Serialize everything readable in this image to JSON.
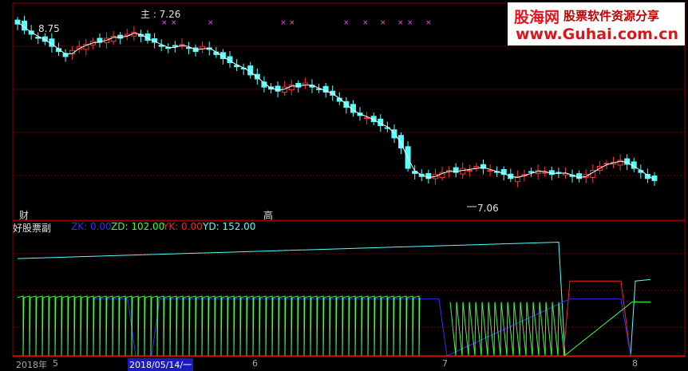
{
  "main_panel": {
    "label": "主 : 7.26",
    "high_label": "8.75",
    "low_label": "7.06",
    "bottom_tag_left": "财",
    "bottom_tag_mid": "高"
  },
  "indicator_panel": {
    "name": "好股票副",
    "zk": "ZK: 0.00",
    "zd": "ZD: 102.00",
    "yk": "YK: 0.00",
    "yd": "YD: 152.00"
  },
  "xaxis": {
    "labels": [
      "2018年",
      "5",
      "2018/05/14/一",
      "6",
      "7",
      "8"
    ]
  },
  "watermark": {
    "brand": "股海网",
    "slogan": "股票软件资源分享",
    "url": "www.Guhai.com.cn"
  },
  "colors": {
    "up": "#ff3333",
    "down": "#54ffff",
    "ma": "#ffffff",
    "zk": "#3030ff",
    "zd": "#38ff38",
    "yk": "#ff2020",
    "yd": "#54ffff",
    "grid": "#900000"
  },
  "chart_data": [
    {
      "type": "candlestick",
      "title": "",
      "annotations": [
        "8.75",
        "7.06"
      ],
      "ylim": [
        6.9,
        8.8
      ],
      "closes": [
        8.72,
        8.66,
        8.62,
        8.58,
        8.55,
        8.5,
        8.45,
        8.4,
        8.46,
        8.5,
        8.52,
        8.55,
        8.54,
        8.58,
        8.6,
        8.58,
        8.62,
        8.64,
        8.6,
        8.56,
        8.54,
        8.5,
        8.48,
        8.5,
        8.52,
        8.48,
        8.45,
        8.5,
        8.47,
        8.42,
        8.38,
        8.34,
        8.3,
        8.28,
        8.22,
        8.18,
        8.1,
        8.08,
        8.06,
        8.1,
        8.12,
        8.1,
        8.14,
        8.1,
        8.08,
        8.05,
        8.02,
        7.96,
        7.9,
        7.85,
        7.82,
        7.8,
        7.76,
        7.72,
        7.7,
        7.6,
        7.5,
        7.3,
        7.25,
        7.22,
        7.2,
        7.24,
        7.26,
        7.28,
        7.26,
        7.3,
        7.28,
        7.32,
        7.3,
        7.28,
        7.26,
        7.24,
        7.2,
        7.22,
        7.24,
        7.26,
        7.28,
        7.26,
        7.24,
        7.26,
        7.25,
        7.22,
        7.2,
        7.24,
        7.28,
        7.32,
        7.35,
        7.36,
        7.38,
        7.34,
        7.3,
        7.26,
        7.2,
        7.18
      ],
      "ma_values_shown": true
    },
    {
      "type": "line",
      "title": "",
      "ylim": [
        0,
        160
      ],
      "series": [
        {
          "name": "ZK",
          "values": "green staircase peaks down to 0"
        },
        {
          "name": "ZD",
          "values": [
            102
          ]
        },
        {
          "name": "YK",
          "values": [
            0
          ]
        },
        {
          "name": "YD",
          "values": [
            152
          ]
        }
      ]
    }
  ]
}
